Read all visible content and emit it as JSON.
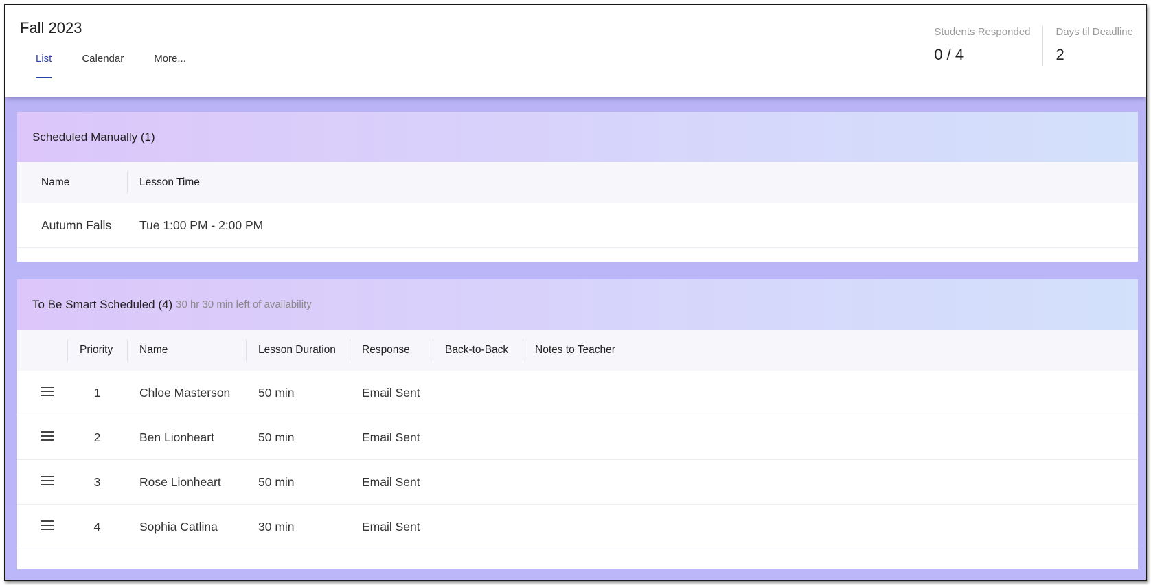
{
  "header": {
    "title": "Fall 2023",
    "tabs": [
      {
        "label": "List",
        "active": true
      },
      {
        "label": "Calendar",
        "active": false
      },
      {
        "label": "More...",
        "active": false
      }
    ],
    "stats": [
      {
        "label": "Students Responded",
        "value": "0 / 4"
      },
      {
        "label": "Days til Deadline",
        "value": "2"
      }
    ]
  },
  "manual": {
    "title": "Scheduled Manually (1)",
    "columns": [
      "Name",
      "Lesson Time"
    ],
    "rows": [
      {
        "name": "Autumn Falls",
        "time": "Tue 1:00 PM - 2:00 PM"
      }
    ]
  },
  "smart": {
    "title": "To Be Smart Scheduled (4)",
    "subtitle": "30 hr 30 min left of availability",
    "columns": [
      "Priority",
      "Name",
      "Lesson Duration",
      "Response",
      "Back-to-Back",
      "Notes to Teacher"
    ],
    "rows": [
      {
        "priority": "1",
        "name": "Chloe Masterson",
        "duration": "50 min",
        "response": "Email Sent",
        "b2b": "",
        "notes": ""
      },
      {
        "priority": "2",
        "name": "Ben Lionheart",
        "duration": "50 min",
        "response": "Email Sent",
        "b2b": "",
        "notes": ""
      },
      {
        "priority": "3",
        "name": "Rose Lionheart",
        "duration": "50 min",
        "response": "Email Sent",
        "b2b": "",
        "notes": ""
      },
      {
        "priority": "4",
        "name": "Sophia Catlina",
        "duration": "30 min",
        "response": "Email Sent",
        "b2b": "",
        "notes": ""
      }
    ]
  },
  "icons": {
    "row_handle": "drag-handle-icon"
  },
  "colors": {
    "accent": "#2d3fa8",
    "background": "#bcb7f8"
  }
}
